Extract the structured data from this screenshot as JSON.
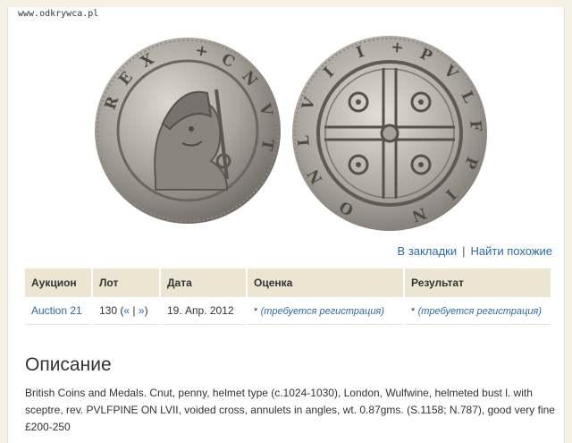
{
  "watermark": "www.odkrywca.pl",
  "coin_images": {
    "obverse_icon": "coin-obverse-image",
    "reverse_icon": "coin-reverse-image",
    "obverse_legend": "CNVT REX",
    "reverse_legend": "PVLFPINE ON LVII"
  },
  "actions": {
    "bookmark": "В закладки",
    "separator": "|",
    "find_similar": "Найти похожие"
  },
  "table": {
    "headers": {
      "auction": "Аукцион",
      "lot": "Лот",
      "date": "Дата",
      "estimate": "Оценка",
      "result": "Результат"
    },
    "row": {
      "auction": "Auction 21",
      "lot": "130",
      "nav_prev": "«",
      "nav_sep": "|",
      "nav_next": "»",
      "date": "19. Апр. 2012",
      "estimate_star": "*",
      "estimate_note": "(требуется регистрация)",
      "result_star": "*",
      "result_note": "(требуется регистрация)"
    }
  },
  "description": {
    "title": "Описание",
    "text": "British Coins and Medals. Cnut, penny, helmet type (c.1024-1030), London, Wulfwine, helmeted bust l. with sceptre, rev. PVLFPINE ON LVII, voided cross, annulets in angles, wt. 0.87gms. (S.1158; N.787), good very fine £200-250"
  },
  "colors": {
    "link": "#2a69b0",
    "header_bg": "#ece5d2",
    "page_bg": "#f6f1e6"
  }
}
